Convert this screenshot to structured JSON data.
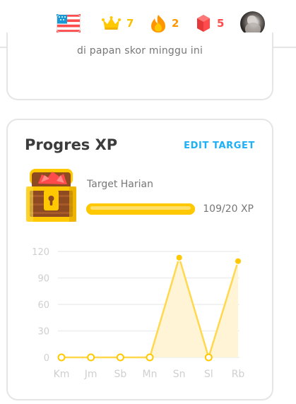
{
  "header": {
    "language_flag": {
      "icon": "us-flag-icon"
    },
    "crowns": {
      "value": "7",
      "icon": "crown-icon",
      "color": "#f6c100"
    },
    "streak": {
      "value": "2",
      "icon": "fire-icon",
      "color": "#ff9600"
    },
    "gems": {
      "value": "5",
      "icon": "gem-icon",
      "color": "#ff4b4b"
    },
    "avatar": {
      "icon": "cat-avatar-icon"
    }
  },
  "leaderboard_card": {
    "text": "di papan skor minggu ini"
  },
  "xp_card": {
    "title": "Progres XP",
    "edit_label": "EDIT TARGET",
    "chest_icon": "treasure-chest-icon",
    "goal_label": "Target Harian",
    "goal_progress": 1.0,
    "goal_value_text": "109/20 XP",
    "colors": {
      "accent": "#ffc800",
      "edit": "#1cb0f6",
      "text": "#3c3c3c",
      "muted": "#777777"
    }
  },
  "chart_data": {
    "type": "area",
    "categories": [
      "Km",
      "Jm",
      "Sb",
      "Mn",
      "Sn",
      "Sl",
      "Rb"
    ],
    "values": [
      0,
      0,
      0,
      0,
      113,
      0,
      109
    ],
    "y_ticks": [
      "0",
      "30",
      "60",
      "90",
      "120"
    ],
    "ylim": [
      0,
      120
    ],
    "grid": true,
    "colors": {
      "line": "#ffd84d",
      "fill": "#fff5d6",
      "point": "#ffc800",
      "grid": "#eeeeee",
      "labels": "#cfcfcf"
    }
  }
}
